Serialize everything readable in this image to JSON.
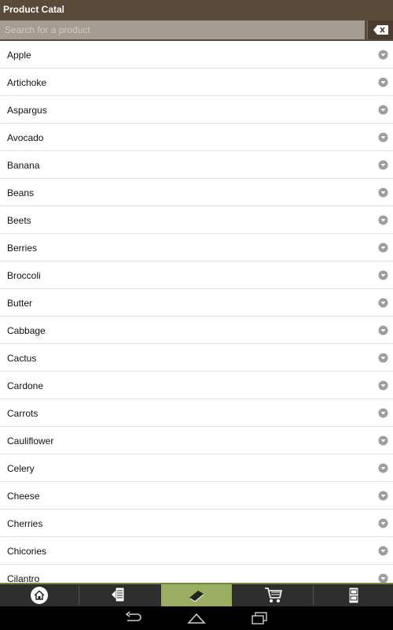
{
  "header": {
    "title": "Product Catalog"
  },
  "search": {
    "placeholder": "Search for a product",
    "value": ""
  },
  "products": [
    "Apple",
    "Artichoke",
    "Aspargus",
    "Avocado",
    "Banana",
    "Beans",
    "Beets",
    "Berries",
    "Broccoli",
    "Butter",
    "Cabbage",
    "Cactus",
    "Cardone",
    "Carrots",
    "Cauliflower",
    "Celery",
    "Cheese",
    "Cherries",
    "Chicories",
    "Cilantro"
  ],
  "bottom_nav": {
    "tabs": [
      {
        "icon": "home-icon",
        "active": false
      },
      {
        "icon": "shopping-list-icon",
        "active": false
      },
      {
        "icon": "catalog-book-icon",
        "active": true
      },
      {
        "icon": "cart-icon",
        "active": false
      },
      {
        "icon": "pantry-icon",
        "active": false
      }
    ]
  },
  "system_nav": {
    "icons": [
      "back-icon",
      "home-icon",
      "recent-apps-icon"
    ]
  },
  "colors": {
    "header_bg": "#5a4a3a",
    "search_bg": "#a39d94",
    "nav_active": "#9aae62",
    "nav_bg": "#2e2e2e"
  }
}
